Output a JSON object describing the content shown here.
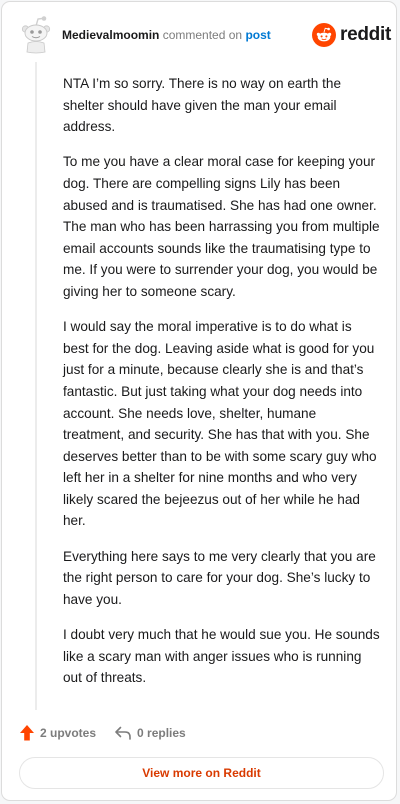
{
  "header": {
    "username": "Medievalmoomin",
    "action_text": "commented on",
    "post_link": "post",
    "brand_name": "reddit"
  },
  "comment": {
    "paragraphs": [
      "NTA I’m so sorry. There is no way on earth the shelter should have given the man your email address.",
      "To me you have a clear moral case for keeping your dog. There are compelling signs Lily has been abused and is traumatised. She has had one owner. The man who has been harrassing you from multiple email accounts sounds like the traumatising type to me. If you were to surrender your dog, you would be giving her to someone scary.",
      "I would say the moral imperative is to do what is best for the dog. Leaving aside what is good for you just for a minute, because clearly she is and that’s fantastic. But just taking what your dog needs into account. She needs love, shelter, humane treatment, and security. She has that with you. She deserves better than to be with some scary guy who left her in a shelter for nine months and who very likely scared the bejeezus out of her while he had her.",
      "Everything here says to me very clearly that you are the right person to care for your dog. She’s lucky to have you.",
      "I doubt very much that he would sue you. He sounds like a scary man with anger issues who is running out of threats."
    ]
  },
  "actions": {
    "upvotes_label": "2 upvotes",
    "replies_label": "0 replies"
  },
  "footer": {
    "view_more_label": "View more on Reddit"
  },
  "icons": {
    "avatar": "snoo-avatar-icon",
    "brand": "reddit-logo-icon",
    "upvote": "upvote-arrow-icon",
    "reply": "reply-arrow-icon"
  },
  "colors": {
    "brand_orange": "#ff4500",
    "link_blue": "#0079d3",
    "view_more_text": "#d93a00",
    "muted_text": "#7c7c7c"
  }
}
